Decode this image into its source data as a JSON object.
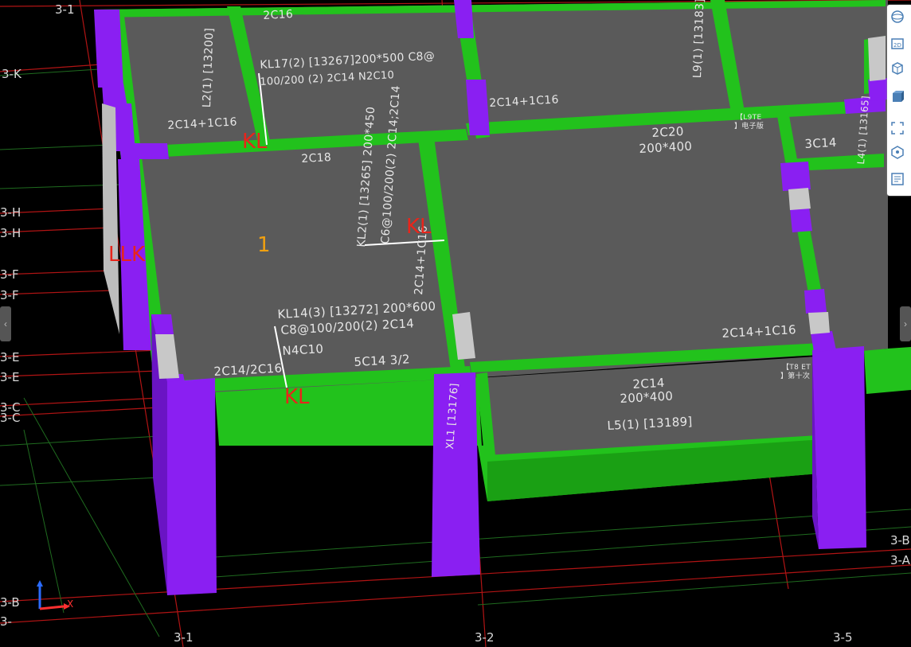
{
  "scene": {
    "type": "3D structural beam model view",
    "colors": {
      "background": "#000000",
      "slab": "#5a5a5a",
      "beam": "#22c21c",
      "beam_dark": "#179e12",
      "column": "#8a1ff2",
      "column_dark": "#6a14c4",
      "grid_line": "#b11414",
      "grid_line_green": "#1f6b1f",
      "label_red": "#e8251b",
      "label_orange": "#f0a010"
    }
  },
  "grid_axes": {
    "left": [
      "3-K",
      "3-H",
      "3-H",
      "3-F",
      "3-F",
      "3-E",
      "3-E",
      "3-C",
      "3-C",
      "3-B",
      "3-"
    ],
    "top": [
      "3-1"
    ],
    "bottom": [
      "3-1",
      "3-2",
      "3-5"
    ],
    "right": [
      "3-B",
      "3-A"
    ]
  },
  "annotations": {
    "beam_2c16_top": "2C16",
    "l2": "L2(1) [13200]",
    "kl17_line1": "KL17(2) [13267]200*500 C8@",
    "kl17_line2": "100/200  (2)   2C14 N2C10",
    "l9": "L9(1) [13183]",
    "rebar_2c14_1c16_a": "2C14+1C16",
    "rebar_2c14_1c16_b": "2C14+1C16",
    "rebar_2c18": "2C18",
    "kl2_line1": "KL2(1) [13265] 200*450",
    "kl2_line2": "C6@100/200(2) 2C14;2C14",
    "rebar_2c14_1c16_vert": "2C14+1C16",
    "slab_2c20": "2C20",
    "slab_200x400_a": "200*400",
    "l9te_line1": "【L9TE",
    "l9te_line2": "】电子版",
    "rebar_3c14": "3C14",
    "l4": "L4(1) [13165]",
    "kl14_line1": "KL14(3) [13272] 200*600",
    "kl14_line2": "C8@100/200(2) 2C14",
    "kl14_line3": "N4C10",
    "rebar_2c14_2c16": "2C14/2C16",
    "rebar_5c14": "5C14 3/2",
    "rebar_2c14_1c16_c": "2C14+1C16",
    "t8et_line1": "【T8 ET",
    "t8et_line2": "】第十次",
    "l5_2c14": "2C14",
    "slab_200x400_b": "200*400",
    "l5": "L5(1) [13189]",
    "xl1": "XL1 [13176]"
  },
  "markers": {
    "kl_1": "KL",
    "kl_2": "KL",
    "kl_3": "KL",
    "llk": "LLK",
    "slab_number": "1"
  },
  "axis_gizmo": {
    "x_label": "X"
  },
  "toolbar": {
    "tools": [
      {
        "name": "sphere-view-icon"
      },
      {
        "name": "2d-view-icon"
      },
      {
        "name": "3d-cube-view-icon"
      },
      {
        "name": "solid-cube-icon"
      },
      {
        "name": "fit-view-icon"
      },
      {
        "name": "iso-cube-icon"
      },
      {
        "name": "properties-icon"
      }
    ]
  }
}
